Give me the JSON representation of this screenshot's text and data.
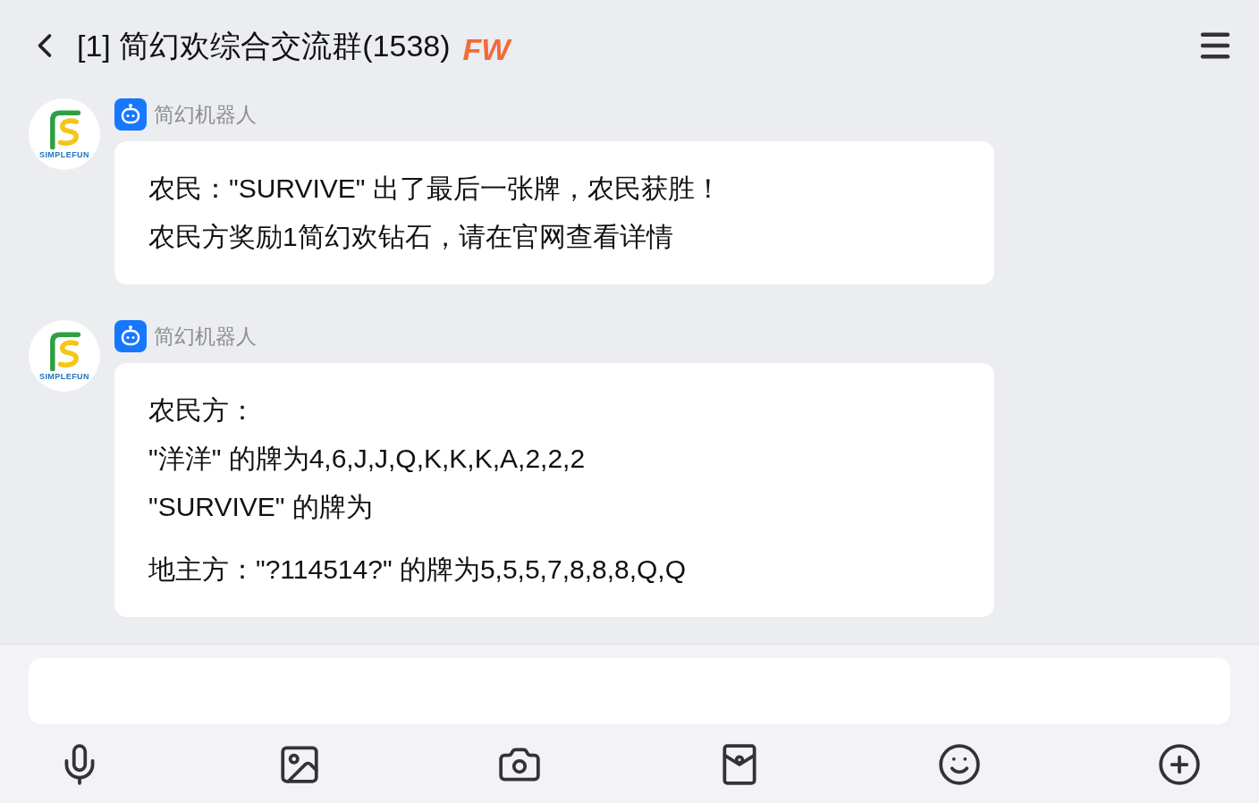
{
  "header": {
    "title": "[1] 简幻欢综合交流群(1538)",
    "badge": "FW"
  },
  "messages": [
    {
      "sender": "简幻机器人",
      "avatar_label": "SIMPLEFUN",
      "blocks": [
        [
          "农民：\"SURVIVE\" 出了最后一张牌，农民获胜！",
          "农民方奖励1简幻欢钻石，请在官网查看详情"
        ]
      ]
    },
    {
      "sender": "简幻机器人",
      "avatar_label": "SIMPLEFUN",
      "blocks": [
        [
          "农民方：",
          "\"洋洋\" 的牌为4,6,J,J,Q,K,K,K,A,2,2,2",
          "\"SURVIVE\" 的牌为"
        ],
        [
          "地主方：\"?114514?\" 的牌为5,5,5,7,8,8,8,Q,Q"
        ]
      ]
    }
  ],
  "toolbar": [
    {
      "kind": "mic"
    },
    {
      "kind": "image"
    },
    {
      "kind": "camera"
    },
    {
      "kind": "envelope"
    },
    {
      "kind": "emoji"
    },
    {
      "kind": "plus"
    }
  ]
}
